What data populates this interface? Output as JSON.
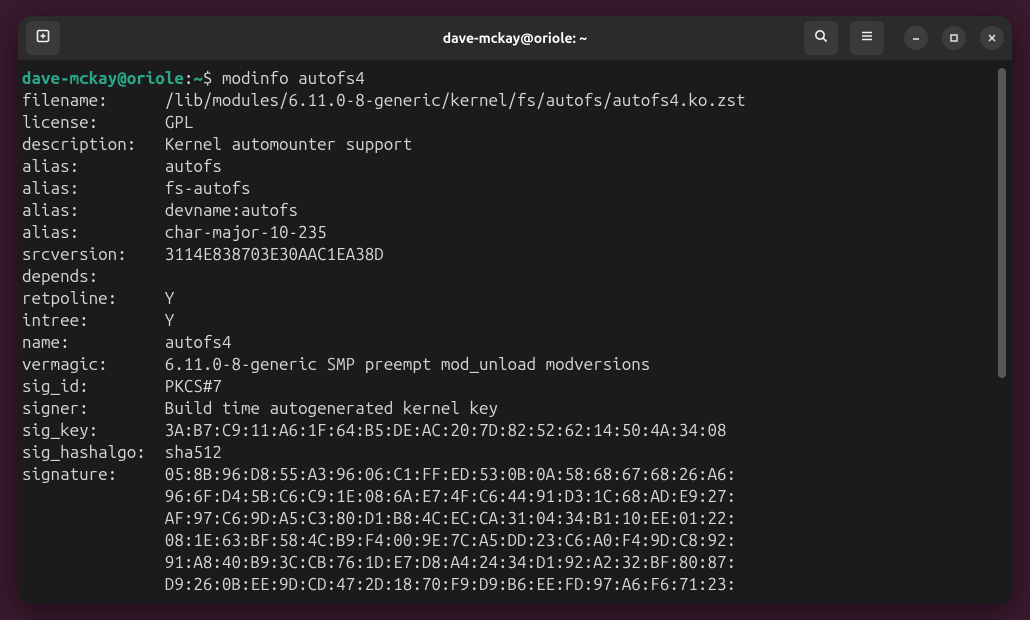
{
  "titlebar": {
    "title": "dave-mckay@oriole: ~"
  },
  "prompt": {
    "user_host": "dave-mckay@oriole",
    "sep1": ":",
    "path": "~",
    "sep2": "$ ",
    "command": "modinfo autofs4"
  },
  "output": [
    {
      "key": "filename:      ",
      "value": "/lib/modules/6.11.0-8-generic/kernel/fs/autofs/autofs4.ko.zst"
    },
    {
      "key": "license:       ",
      "value": "GPL"
    },
    {
      "key": "description:   ",
      "value": "Kernel automounter support"
    },
    {
      "key": "alias:         ",
      "value": "autofs"
    },
    {
      "key": "alias:         ",
      "value": "fs-autofs"
    },
    {
      "key": "alias:         ",
      "value": "devname:autofs"
    },
    {
      "key": "alias:         ",
      "value": "char-major-10-235"
    },
    {
      "key": "srcversion:    ",
      "value": "3114E838703E30AAC1EA38D"
    },
    {
      "key": "depends:       ",
      "value": ""
    },
    {
      "key": "retpoline:     ",
      "value": "Y"
    },
    {
      "key": "intree:        ",
      "value": "Y"
    },
    {
      "key": "name:          ",
      "value": "autofs4"
    },
    {
      "key": "vermagic:      ",
      "value": "6.11.0-8-generic SMP preempt mod_unload modversions "
    },
    {
      "key": "sig_id:        ",
      "value": "PKCS#7"
    },
    {
      "key": "signer:        ",
      "value": "Build time autogenerated kernel key"
    },
    {
      "key": "sig_key:       ",
      "value": "3A:B7:C9:11:A6:1F:64:B5:DE:AC:20:7D:82:52:62:14:50:4A:34:08"
    },
    {
      "key": "sig_hashalgo:  ",
      "value": "sha512"
    },
    {
      "key": "signature:     ",
      "value": "05:8B:96:D8:55:A3:96:06:C1:FF:ED:53:0B:0A:58:68:67:68:26:A6:"
    },
    {
      "key": "               ",
      "value": "96:6F:D4:5B:C6:C9:1E:08:6A:E7:4F:C6:44:91:D3:1C:68:AD:E9:27:"
    },
    {
      "key": "               ",
      "value": "AF:97:C6:9D:A5:C3:80:D1:B8:4C:EC:CA:31:04:34:B1:10:EE:01:22:"
    },
    {
      "key": "               ",
      "value": "08:1E:63:BF:58:4C:B9:F4:00:9E:7C:A5:DD:23:C6:A0:F4:9D:C8:92:"
    },
    {
      "key": "               ",
      "value": "91:A8:40:B9:3C:CB:76:1D:E7:D8:A4:24:34:D1:92:A2:32:BF:80:87:"
    },
    {
      "key": "               ",
      "value": "D9:26:0B:EE:9D:CD:47:2D:18:70:F9:D9:B6:EE:FD:97:A6:F6:71:23:"
    }
  ]
}
